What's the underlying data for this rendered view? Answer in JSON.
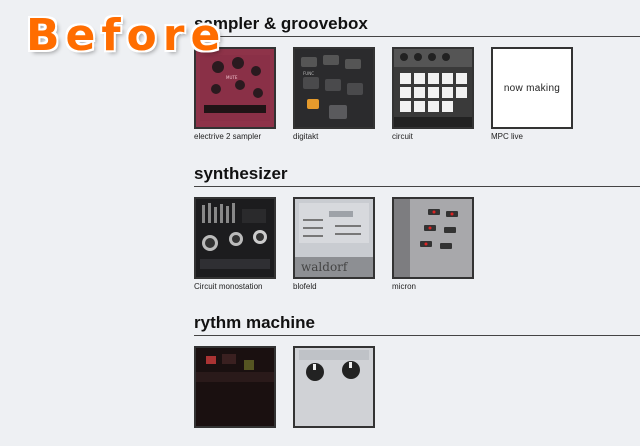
{
  "badge": "Before",
  "sections": [
    {
      "title": "sampler & groovebox",
      "items": [
        {
          "caption": "electrive 2 sampler",
          "image": "pink-sampler-photo"
        },
        {
          "caption": "digitakt",
          "image": "digitakt-photo"
        },
        {
          "caption": "circuit",
          "image": "circuit-pad-photo"
        },
        {
          "caption": "MPC live",
          "image": "placeholder",
          "placeholder_text": "now making"
        }
      ]
    },
    {
      "title": "synthesizer",
      "items": [
        {
          "caption": "Circuit monostation",
          "image": "monostation-photo"
        },
        {
          "caption": "blofeld",
          "image": "blofeld-photo"
        },
        {
          "caption": "micron",
          "image": "micron-photo"
        }
      ]
    },
    {
      "title": "rythm machine",
      "items": [
        {
          "caption": "",
          "image": "rhythm-machine-photo"
        },
        {
          "caption": "",
          "image": "knob-panel-photo"
        }
      ]
    }
  ]
}
